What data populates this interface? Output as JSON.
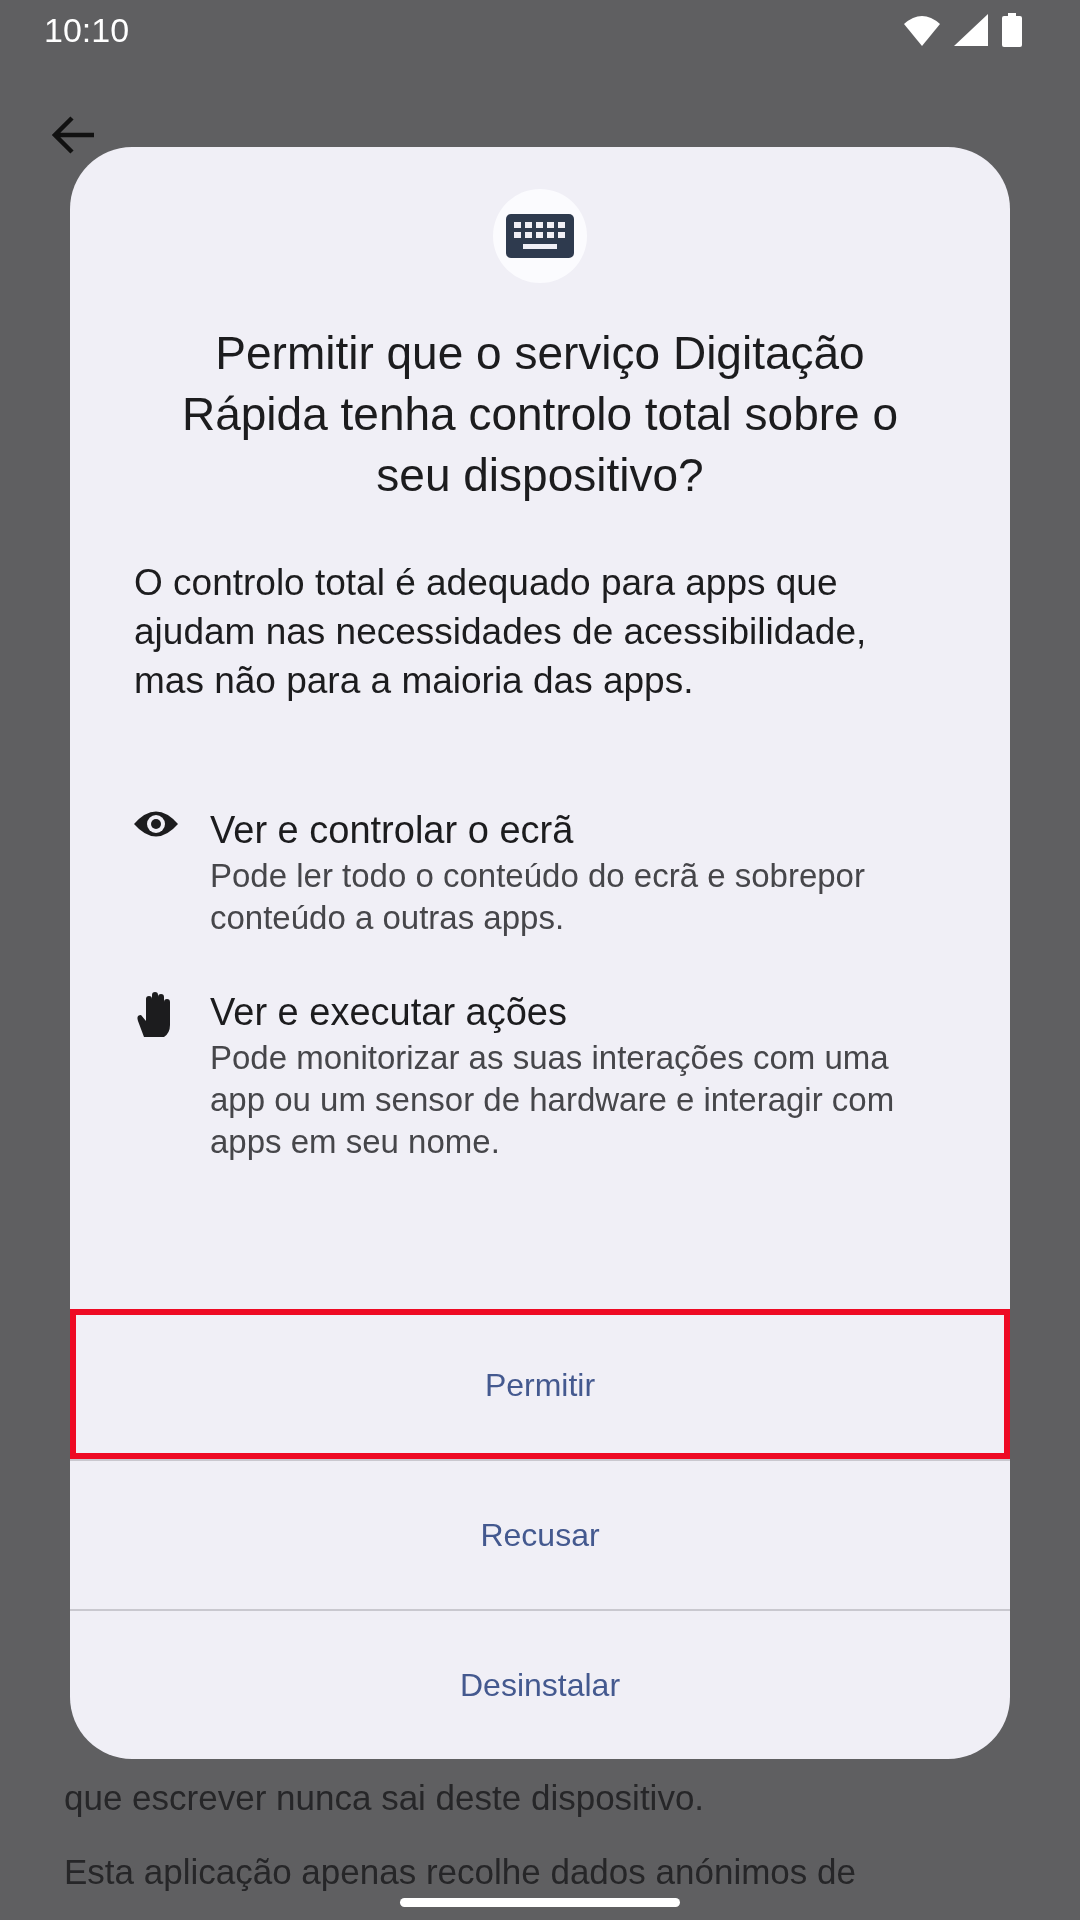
{
  "status_bar": {
    "time": "10:10"
  },
  "background": {
    "lines": [
      "que escrever nunca sai deste dispositivo.",
      "Esta aplicação apenas recolhe dados anónimos de"
    ]
  },
  "dialog": {
    "title": "Permitir que o serviço Digitação Rápida tenha controlo total sobre o seu dispositivo?",
    "message": "O controlo total é adequado para apps que ajudam nas necessidades de acessibilidade, mas não para a maioria das apps.",
    "permissions": [
      {
        "kind": "eye",
        "title": "Ver e controlar o ecrã",
        "description": "Pode ler todo o conteúdo do ecrã e sobrepor conteúdo a outras apps."
      },
      {
        "kind": "hand",
        "title": "Ver e executar ações",
        "description": "Pode monitorizar as suas interações com uma app ou um sensor de hardware e interagir com apps em seu nome."
      }
    ],
    "buttons": [
      {
        "label": "Permitir",
        "highlighted": true
      },
      {
        "label": "Recusar",
        "highlighted": false
      },
      {
        "label": "Desinstalar",
        "highlighted": false
      }
    ]
  }
}
